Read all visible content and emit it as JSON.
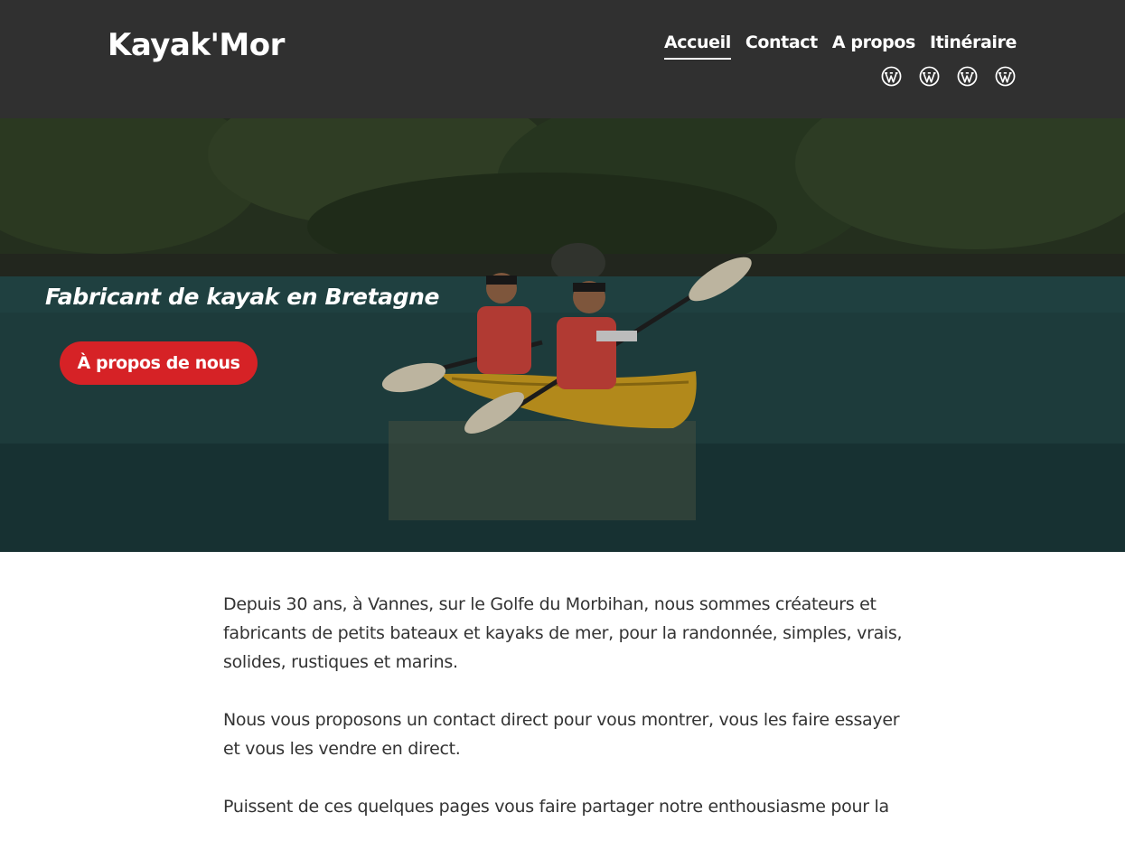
{
  "header": {
    "site_title": "Kayak'Mor",
    "nav": [
      {
        "label": "Accueil",
        "active": true
      },
      {
        "label": "Contact",
        "active": false
      },
      {
        "label": "A propos",
        "active": false
      },
      {
        "label": "Itinéraire",
        "active": false
      }
    ],
    "social_icons": [
      "wordpress-icon",
      "wordpress-icon",
      "wordpress-icon",
      "wordpress-icon"
    ]
  },
  "hero": {
    "tagline": "Fabricant de kayak en Bretagne",
    "button_label": "À propos de nous"
  },
  "content": {
    "paragraphs": [
      "Depuis 30 ans, à Vannes, sur le Golfe du Morbihan, nous sommes créateurs et fabricants de petits bateaux et kayaks de mer, pour la randonnée, simples, vrais, solides, rustiques et marins.",
      "Nous vous proposons un contact direct pour vous montrer, vous les faire essayer et vous les vendre en direct.",
      "Puissent de ces quelques pages vous faire partager notre enthousiasme pour la"
    ]
  },
  "colors": {
    "header_bg": "#303030",
    "accent": "#d62226",
    "text": "#333333"
  }
}
